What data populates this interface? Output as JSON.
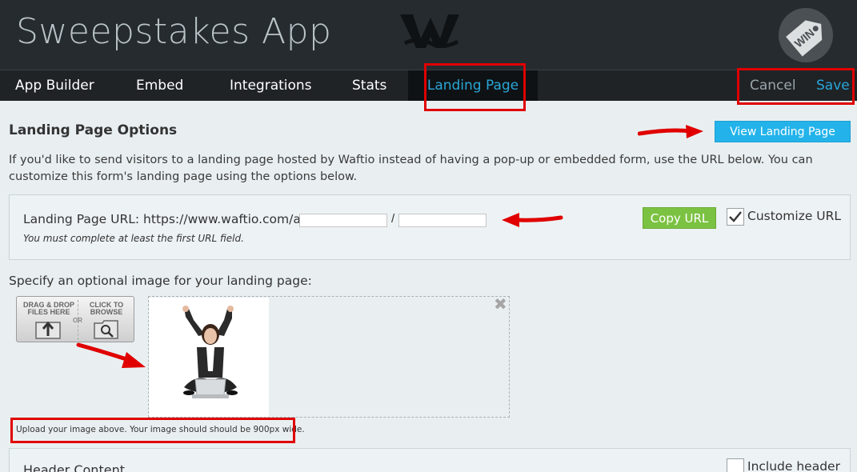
{
  "header": {
    "app_title": "Sweepstakes App",
    "logo_icon": "waftio-logo-icon",
    "badge_icon": "win-tag-icon",
    "badge_text": "WIN"
  },
  "nav": {
    "tabs": [
      {
        "label": "App Builder"
      },
      {
        "label": "Embed"
      },
      {
        "label": "Integrations"
      },
      {
        "label": "Stats"
      },
      {
        "label": "Landing Page",
        "active": true
      }
    ],
    "cancel_label": "Cancel",
    "save_label": "Save"
  },
  "landing": {
    "title": "Landing Page Options",
    "view_button": "View Landing Page",
    "description": "If you'd like to send visitors to a landing page hosted by Waftio instead of having a pop-up or embedded form, use the URL below. You can customize this form's landing page using the options below.",
    "url_label": "Landing Page URL: https://www.waftio.com/a/",
    "url_field_1": "",
    "url_separator": "/",
    "url_field_2": "",
    "url_note": "You must complete at least the first URL field.",
    "copy_button": "Copy URL",
    "customize_label": "Customize URL",
    "customize_checked": true
  },
  "image": {
    "label": "Specify an optional image for your landing page:",
    "drop_text": "DRAG & DROP FILES HERE",
    "or_text": "OR",
    "browse_text": "CLICK TO BROWSE",
    "remove_icon": "close-icon",
    "helper": "Upload your image above. Your image should should be 900px wide."
  },
  "header_content": {
    "title": "Header Content",
    "include_label": "Include header",
    "include_checked": false
  },
  "colors": {
    "accent": "#2aa6d8",
    "green": "#7cc242",
    "annotation": "#e00000"
  }
}
